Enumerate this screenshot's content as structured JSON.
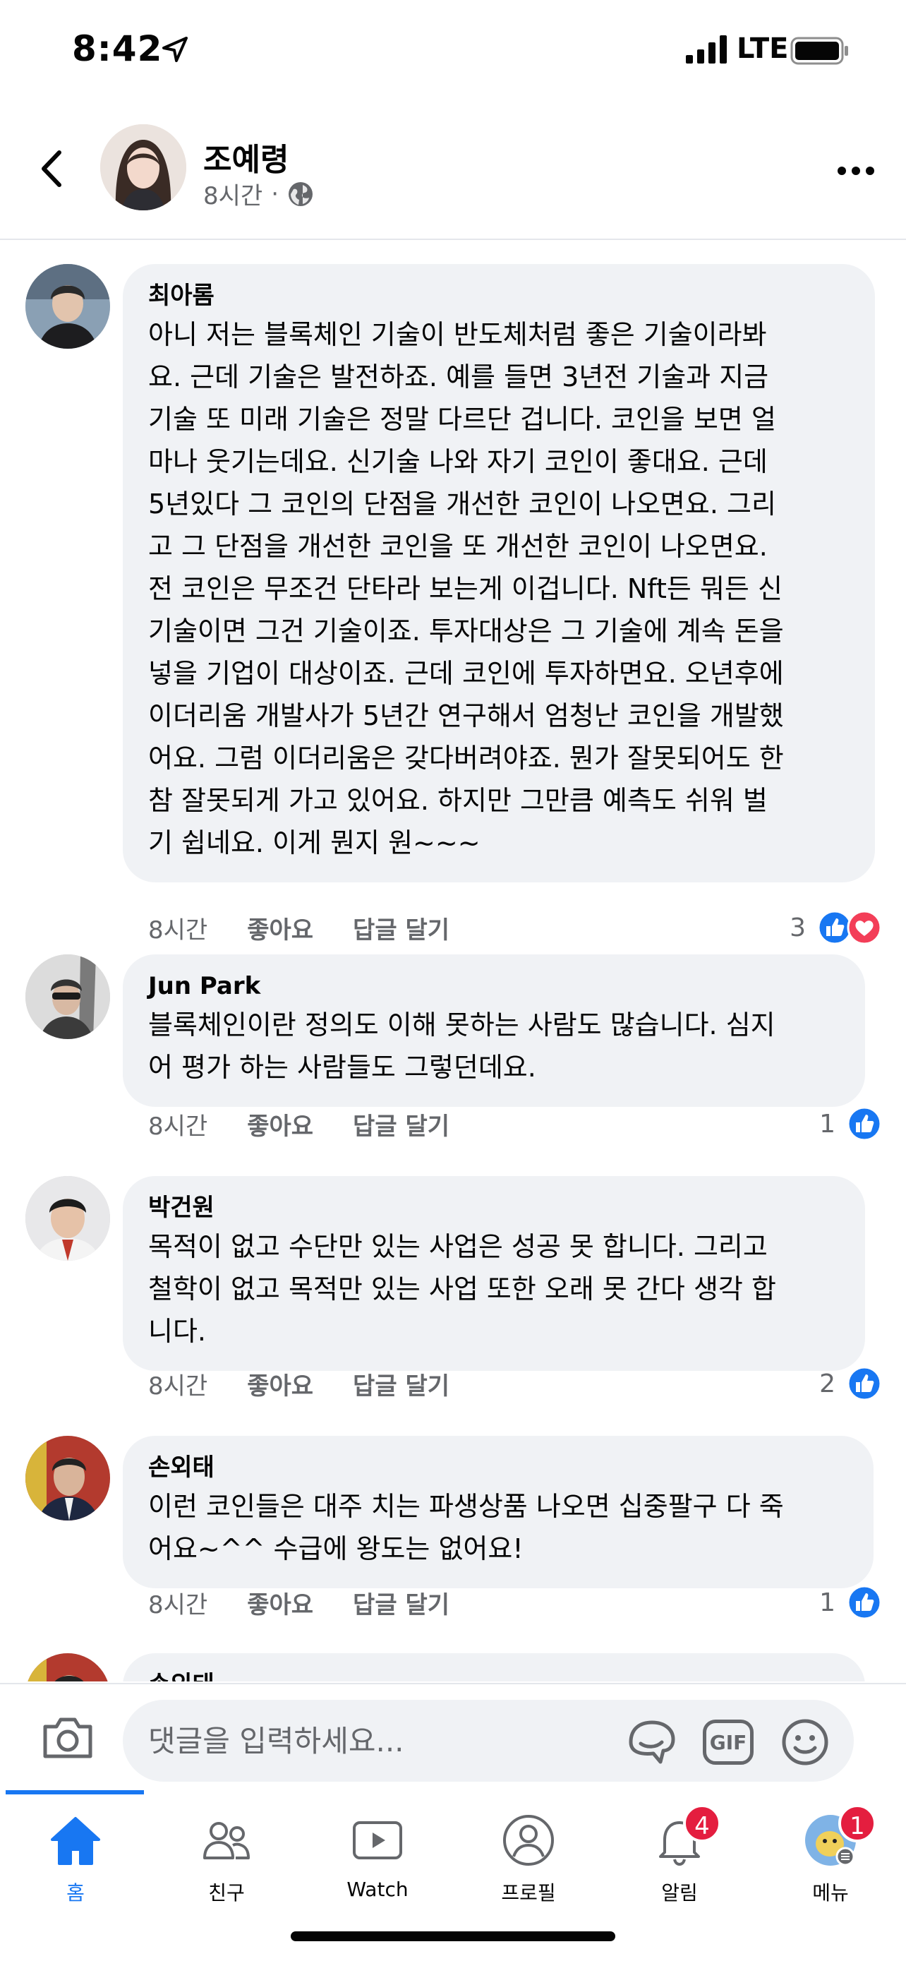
{
  "status_bar": {
    "time": "8:42",
    "network": "LTE"
  },
  "header": {
    "name": "조예령",
    "time_ago": "8시간",
    "separator": "·"
  },
  "comments": [
    {
      "author": "최아롬",
      "text": "아니 저는 블록체인 기술이 반도체처럼 좋은 기술이라봐\n요. 근데 기술은 발전하죠. 예를 들면 3년전 기술과 지금\n기술 또 미래 기술은 정말 다르단 겁니다. 코인을 보면 얼\n마나 웃기는데요. 신기술 나와 자기 코인이 좋대요. 근데\n5년있다 그 코인의 단점을 개선한 코인이 나오면요. 그리\n고 그 단점을 개선한 코인을 또 개선한 코인이 나오면요.\n전 코인은 무조건 단타라 보는게 이겁니다. Nft든 뭐든 신\n기술이면 그건 기술이죠. 투자대상은 그 기술에 계속 돈을\n넣을 기업이 대상이죠. 근데 코인에 투자하면요. 오년후에\n이더리움 개발사가 5년간 연구해서 엄청난 코인을 개발했\n어요. 그럼 이더리움은 갖다버려야죠. 뭔가 잘못되어도 한\n참 잘못되게 가고 있어요. 하지만 그만큼 예측도 쉬워 벌\n기 쉽네요. 이게 뭔지 원~~~",
      "time_ago": "8시간",
      "like_label": "좋아요",
      "reply_label": "답글 달기",
      "reaction_count": "3",
      "reactions": [
        "like-icon",
        "love-icon"
      ]
    },
    {
      "author": "Jun Park",
      "text": "블록체인이란 정의도 이해 못하는 사람도 많습니다. 심지\n어 평가 하는 사람들도 그렇던데요.",
      "time_ago": "8시간",
      "like_label": "좋아요",
      "reply_label": "답글 달기",
      "reaction_count": "1",
      "reactions": [
        "like-icon"
      ]
    },
    {
      "author": "박건원",
      "text": "목적이 없고 수단만 있는 사업은 성공 못 합니다. 그리고\n철학이 없고 목적만 있는 사업 또한 오래 못 간다 생각 합\n니다.",
      "time_ago": "8시간",
      "like_label": "좋아요",
      "reply_label": "답글 달기",
      "reaction_count": "2",
      "reactions": [
        "like-icon"
      ]
    },
    {
      "author": "손외태",
      "text": "이런 코인들은 대주 치는 파생상품 나오면 십중팔구 다 죽\n어요~^^ 수급에 왕도는 없어요!",
      "time_ago": "8시간",
      "like_label": "좋아요",
      "reply_label": "답글 달기",
      "reaction_count": "1",
      "reactions": [
        "like-icon"
      ]
    },
    {
      "author": "손외태",
      "text": "",
      "partial": true
    }
  ],
  "composer": {
    "placeholder": "댓글을 입력하세요...",
    "gif_label": "GIF"
  },
  "tabs": [
    {
      "label": "홈",
      "icon": "home-icon",
      "active": true
    },
    {
      "label": "친구",
      "icon": "friends-icon"
    },
    {
      "label": "Watch",
      "icon": "watch-icon"
    },
    {
      "label": "프로필",
      "icon": "profile-icon"
    },
    {
      "label": "알림",
      "icon": "bell-icon",
      "badge": "4"
    },
    {
      "label": "메뉴",
      "icon": "menu-avatar-icon",
      "badge": "1"
    }
  ],
  "colors": {
    "accent": "#1877f2",
    "bubble": "#f0f2f5",
    "badge": "#e41e3f",
    "love": "#f33e58",
    "secondary_text": "#65676b"
  }
}
